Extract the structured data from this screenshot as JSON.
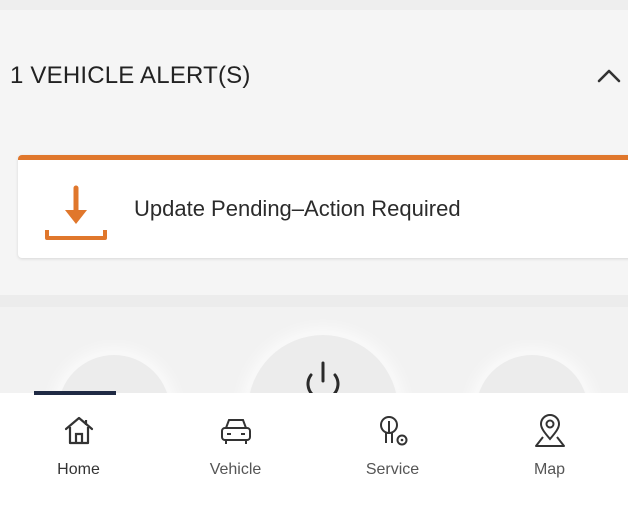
{
  "alerts": {
    "title": "1 VEHICLE ALERT(S)",
    "collapse_icon": "chevron-up-icon",
    "items": [
      {
        "icon": "download-icon",
        "label": "Update Pending–Action Required",
        "accent_color": "#e0772c"
      }
    ]
  },
  "controls": {
    "center_icon": "power-icon"
  },
  "tabs": [
    {
      "label": "Home",
      "icon": "home-icon",
      "active": true
    },
    {
      "label": "Vehicle",
      "icon": "car-icon",
      "active": false
    },
    {
      "label": "Service",
      "icon": "service-icon",
      "active": false
    },
    {
      "label": "Map",
      "icon": "map-pin-icon",
      "active": false
    }
  ],
  "colors": {
    "accent": "#e0772c",
    "tab_indicator": "#1f2a44",
    "background": "#f5f5f5"
  }
}
